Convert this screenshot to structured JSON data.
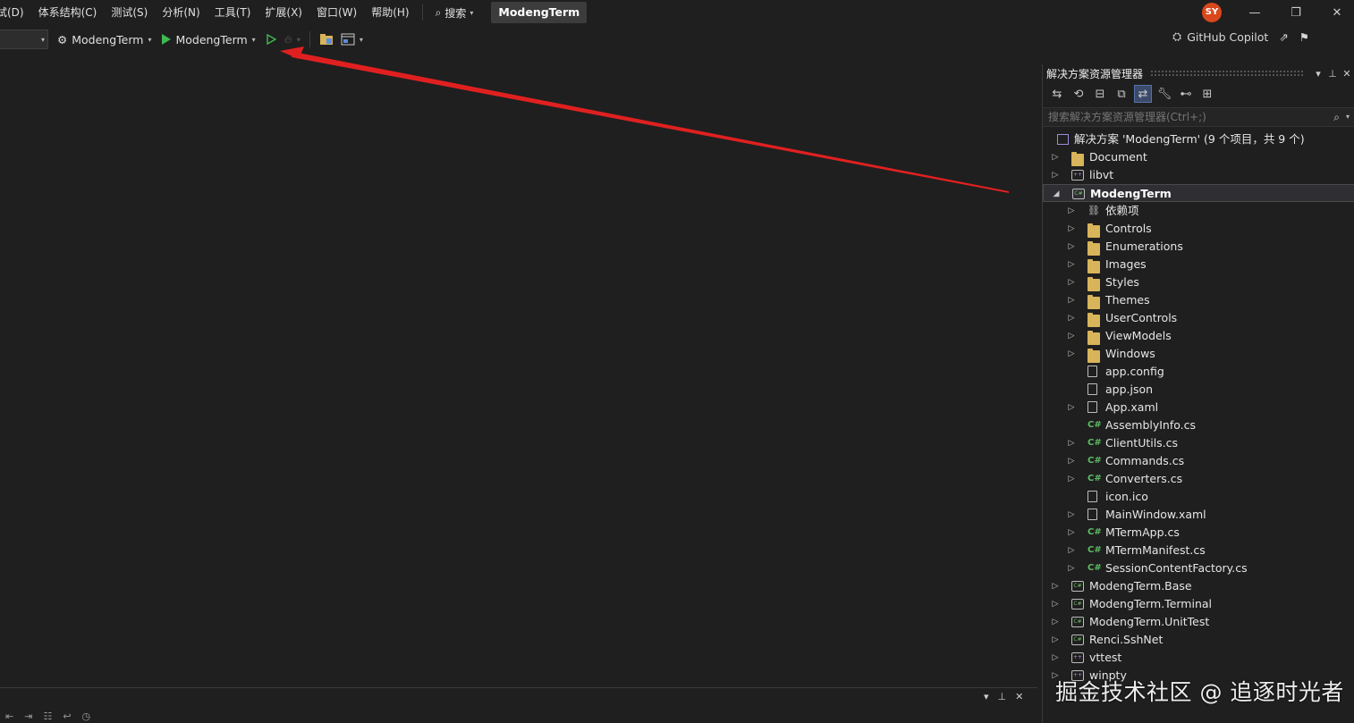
{
  "menu": {
    "items": [
      "试(D)",
      "体系结构(C)",
      "测试(S)",
      "分析(N)",
      "工具(T)",
      "扩展(X)",
      "窗口(W)",
      "帮助(H)"
    ],
    "search_label": "搜索",
    "title": "ModengTerm"
  },
  "user": {
    "initials": "SY"
  },
  "window_controls": {
    "minimize": "—",
    "restore": "❐",
    "close": "✕"
  },
  "toolbar": {
    "startup_project": "ModengTerm",
    "run_target": "ModengTerm"
  },
  "copilot": {
    "label": "GitHub Copilot"
  },
  "solution_explorer": {
    "title": "解决方案资源管理器",
    "search_placeholder": "搜索解决方案资源管理器(Ctrl+;)",
    "tree": [
      {
        "label": "解决方案 'ModengTerm' (9 个项目，共 9 个)",
        "kind": "solution",
        "level": 0,
        "expandable": false
      },
      {
        "label": "Document",
        "kind": "folder",
        "level": 1,
        "expandable": true
      },
      {
        "label": "libvt",
        "kind": "project-vc",
        "level": 1,
        "expandable": true
      },
      {
        "label": "ModengTerm",
        "kind": "project",
        "level": 1,
        "expandable": true,
        "expanded": true,
        "selected": true
      },
      {
        "label": "依赖项",
        "kind": "dependency",
        "level": 2,
        "expandable": true
      },
      {
        "label": "Controls",
        "kind": "folder",
        "level": 2,
        "expandable": true
      },
      {
        "label": "Enumerations",
        "kind": "folder",
        "level": 2,
        "expandable": true
      },
      {
        "label": "Images",
        "kind": "folder",
        "level": 2,
        "expandable": true
      },
      {
        "label": "Styles",
        "kind": "folder",
        "level": 2,
        "expandable": true
      },
      {
        "label": "Themes",
        "kind": "folder",
        "level": 2,
        "expandable": true
      },
      {
        "label": "UserControls",
        "kind": "folder",
        "level": 2,
        "expandable": true
      },
      {
        "label": "ViewModels",
        "kind": "folder",
        "level": 2,
        "expandable": true
      },
      {
        "label": "Windows",
        "kind": "folder",
        "level": 2,
        "expandable": true
      },
      {
        "label": "app.config",
        "kind": "file",
        "level": 2,
        "expandable": false
      },
      {
        "label": "app.json",
        "kind": "file",
        "level": 2,
        "expandable": false
      },
      {
        "label": "App.xaml",
        "kind": "file",
        "level": 2,
        "expandable": true
      },
      {
        "label": "AssemblyInfo.cs",
        "kind": "cs",
        "level": 2,
        "expandable": false
      },
      {
        "label": "ClientUtils.cs",
        "kind": "cs",
        "level": 2,
        "expandable": true
      },
      {
        "label": "Commands.cs",
        "kind": "cs",
        "level": 2,
        "expandable": true
      },
      {
        "label": "Converters.cs",
        "kind": "cs",
        "level": 2,
        "expandable": true
      },
      {
        "label": "icon.ico",
        "kind": "file",
        "level": 2,
        "expandable": false
      },
      {
        "label": "MainWindow.xaml",
        "kind": "file",
        "level": 2,
        "expandable": true
      },
      {
        "label": "MTermApp.cs",
        "kind": "cs",
        "level": 2,
        "expandable": true
      },
      {
        "label": "MTermManifest.cs",
        "kind": "cs",
        "level": 2,
        "expandable": true
      },
      {
        "label": "SessionContentFactory.cs",
        "kind": "cs",
        "level": 2,
        "expandable": true
      },
      {
        "label": "ModengTerm.Base",
        "kind": "project",
        "level": 1,
        "expandable": true
      },
      {
        "label": "ModengTerm.Terminal",
        "kind": "project",
        "level": 1,
        "expandable": true
      },
      {
        "label": "ModengTerm.UnitTest",
        "kind": "project",
        "level": 1,
        "expandable": true
      },
      {
        "label": "Renci.SshNet",
        "kind": "project",
        "level": 1,
        "expandable": true
      },
      {
        "label": "vttest",
        "kind": "project-vc",
        "level": 1,
        "expandable": true
      },
      {
        "label": "winpty",
        "kind": "project-vc",
        "level": 1,
        "expandable": true
      }
    ]
  },
  "watermark": "掘金技术社区 @ 追逐时光者",
  "colors": {
    "background": "#1f1f1f",
    "run_green": "#3fb950",
    "annotation_red": "#e02020",
    "avatar": "#d9481c",
    "folder": "#d8b45a"
  }
}
